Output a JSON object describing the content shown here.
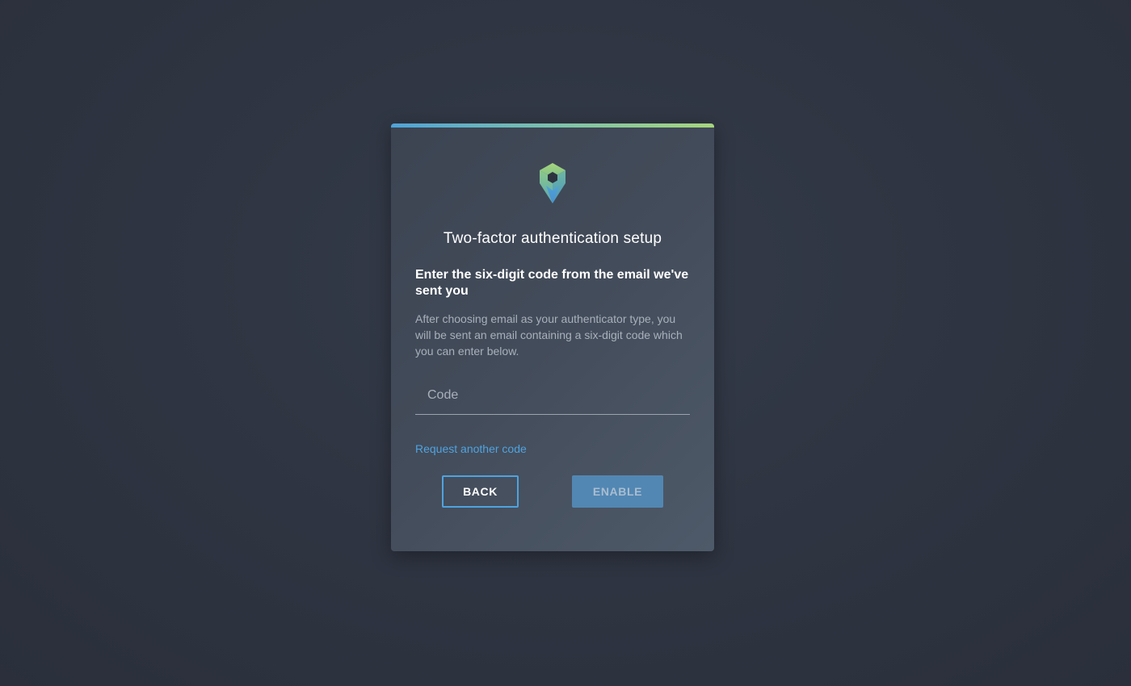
{
  "dialog": {
    "title": "Two-factor authentication setup",
    "subtitle": "Enter the six-digit code from the email we've sent you",
    "description": "After choosing email as your authenticator type, you will be sent an email containing a six-digit code which you can enter below.",
    "code_input": {
      "placeholder": "Code",
      "value": ""
    },
    "request_link": "Request another code",
    "back_label": "BACK",
    "enable_label": "ENABLE",
    "enable_disabled": true
  },
  "icons": {
    "logo": "hexagon-pin-logo-icon"
  },
  "colors": {
    "accent_blue": "#4fa3e0",
    "accent_green": "#a7d67c",
    "enable_button": "#5287b3",
    "background": "#2f3542"
  }
}
